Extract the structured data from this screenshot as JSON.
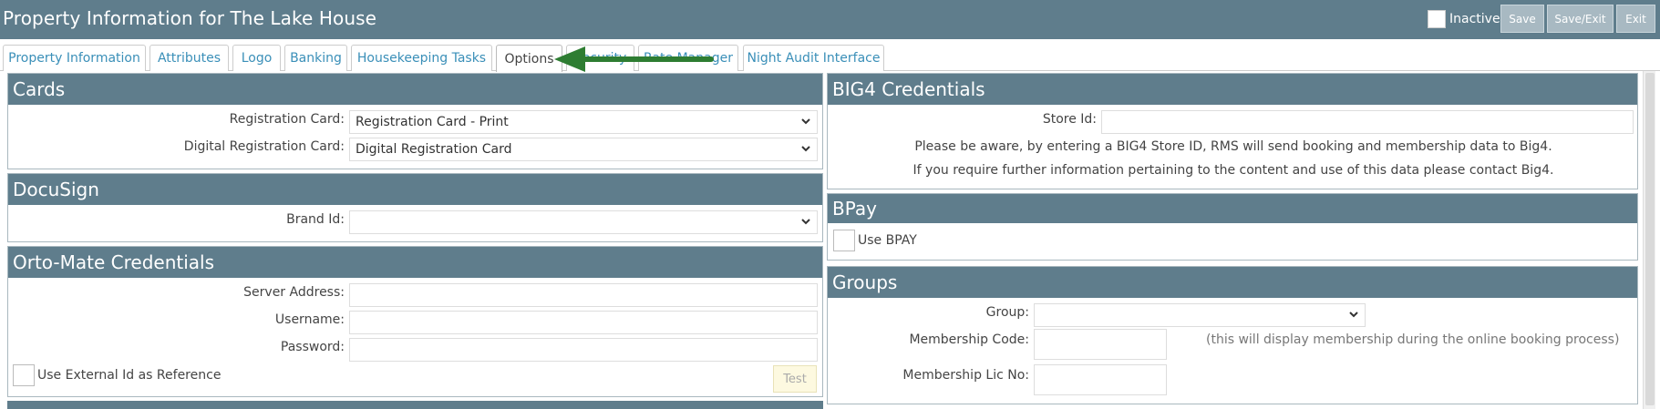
{
  "header": {
    "title": "Property Information for The Lake House",
    "inactive_label": "Inactive",
    "buttons": {
      "save": "Save",
      "save_exit": "Save/Exit",
      "exit": "Exit"
    }
  },
  "tabs": [
    {
      "label": "Property Information"
    },
    {
      "label": "Attributes"
    },
    {
      "label": "Logo"
    },
    {
      "label": "Banking"
    },
    {
      "label": "Housekeeping Tasks"
    },
    {
      "label": "Options",
      "active": true
    },
    {
      "label": "Security"
    },
    {
      "label": "Rate Manager"
    },
    {
      "label": "Night Audit Interface"
    }
  ],
  "cards": {
    "title": "Cards",
    "registration_card_label": "Registration Card:",
    "registration_card_value": "Registration Card - Print",
    "digital_registration_card_label": "Digital Registration Card:",
    "digital_registration_card_value": "Digital Registration Card"
  },
  "docusign": {
    "title": "DocuSign",
    "brand_id_label": "Brand Id:",
    "brand_id_value": ""
  },
  "ortomate": {
    "title": "Orto-Mate Credentials",
    "server_address_label": "Server Address:",
    "username_label": "Username:",
    "password_label": "Password:",
    "use_external_id_label": "Use External Id as Reference",
    "test_button": "Test"
  },
  "big4": {
    "title": "BIG4 Credentials",
    "store_id_label": "Store Id:",
    "notice_line1": "Please be aware, by entering a BIG4 Store ID, RMS will send booking and membership data to Big4.",
    "notice_line2": "If you require further information pertaining to the content and use of this data please contact Big4."
  },
  "bpay": {
    "title": "BPay",
    "use_bpay_label": "Use BPAY"
  },
  "groups": {
    "title": "Groups",
    "group_label": "Group:",
    "membership_code_label": "Membership Code:",
    "membership_hint": "(this will display membership during the online booking process)",
    "membership_lic_label": "Membership Lic No:"
  },
  "colors": {
    "header_bg": "#5f7d8c",
    "tab_link": "#3a8fb8",
    "arrow": "#2e7d32"
  }
}
